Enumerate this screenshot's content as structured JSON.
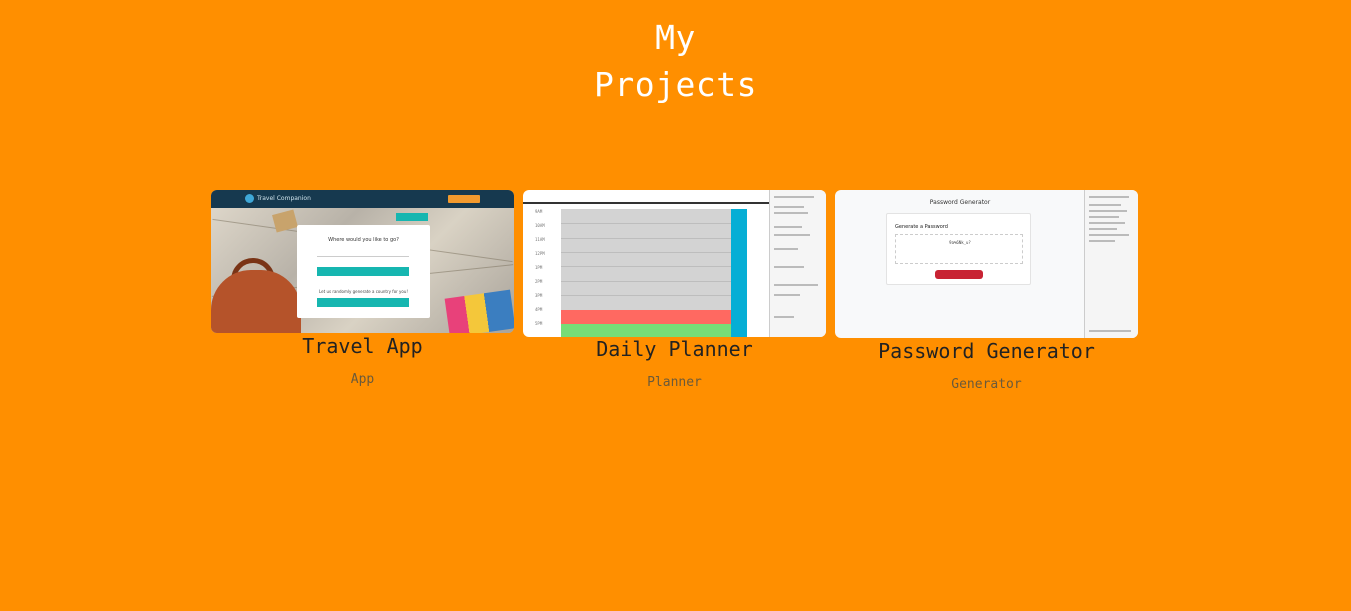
{
  "header": {
    "title_line1": "My",
    "title_line2": "Projects"
  },
  "projects": [
    {
      "name": "Travel App",
      "tag": "App",
      "thumb": {
        "brand": "Travel Companion",
        "question": "Where would you like to go?",
        "random_text": "Let us randomly generate a country for you!"
      }
    },
    {
      "name": "Daily Planner",
      "tag": "Planner",
      "thumb": {
        "hours": [
          "9AM",
          "10AM",
          "11AM",
          "12PM",
          "1PM",
          "2PM",
          "3PM",
          "4PM",
          "5PM"
        ]
      }
    },
    {
      "name": "Password Generator",
      "tag": "Generator",
      "thumb": {
        "title": "Password Generator",
        "card_heading": "Generate a Password",
        "password": "9a%6Nk_u?"
      }
    }
  ],
  "colors": {
    "background": "#ff8f00",
    "title": "#ffffff",
    "teal": "#16b6b0",
    "save_blue": "#06aed5",
    "past_red": "#ff6961",
    "future_green": "#77dd77",
    "generate_red": "#c82333"
  }
}
